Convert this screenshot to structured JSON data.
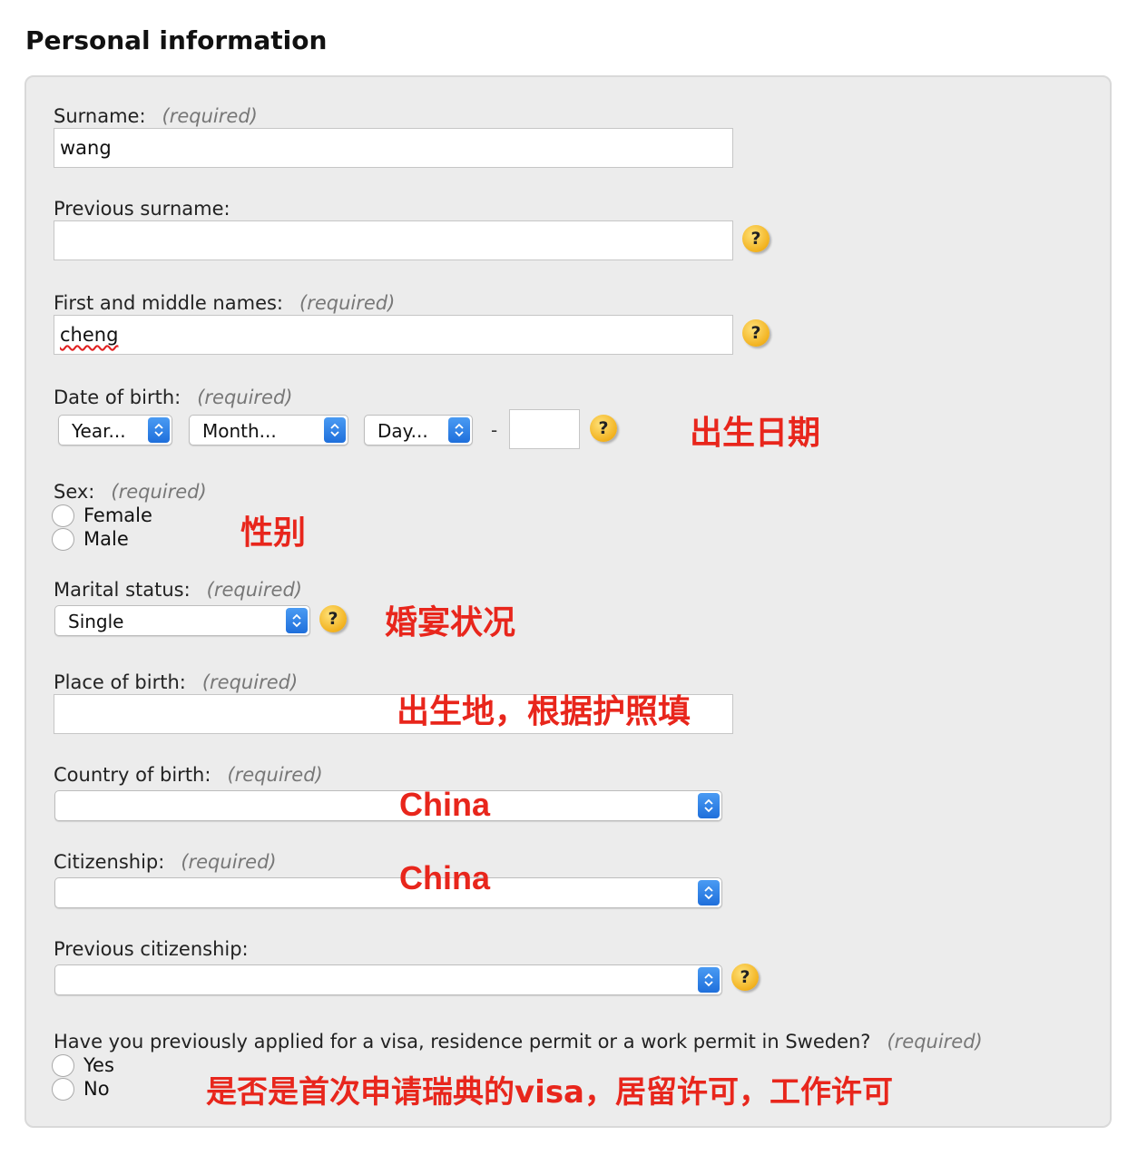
{
  "section_title": "Personal information",
  "required_text": "(required)",
  "fields": {
    "surname": {
      "label": "Surname:",
      "value": "wang"
    },
    "previous_surname": {
      "label": "Previous surname:",
      "value": ""
    },
    "first_names": {
      "label": "First and middle names:",
      "value": "cheng"
    },
    "date_of_birth": {
      "label": "Date of birth:",
      "year": "Year...",
      "month": "Month...",
      "day": "Day...",
      "separator": "-",
      "extra_value": ""
    },
    "sex": {
      "label": "Sex:",
      "options": [
        "Female",
        "Male"
      ]
    },
    "marital_status": {
      "label": "Marital status:",
      "value": "Single"
    },
    "place_of_birth": {
      "label": "Place of birth:",
      "value": ""
    },
    "country_of_birth": {
      "label": "Country of birth:",
      "value": ""
    },
    "citizenship": {
      "label": "Citizenship:",
      "value": ""
    },
    "previous_citizenship": {
      "label": "Previous citizenship:",
      "value": ""
    },
    "previous_application": {
      "label": "Have you previously applied for a visa, residence permit or a work permit in Sweden?",
      "options": [
        "Yes",
        "No"
      ]
    }
  },
  "help_icon_text": "?",
  "annotations": {
    "date_of_birth": "出生日期",
    "sex": "性别",
    "marital_status": "婚宴状况",
    "place_of_birth": "出生地，根据护照填",
    "country_of_birth": "China",
    "citizenship": "China",
    "previous_application": "是否是首次申请瑞典的visa，居留许可，工作许可"
  },
  "colors": {
    "annotation": "#e8261c",
    "panel_bg": "#ececec",
    "select_arrow": "#2a7de8",
    "help_icon": "#f2b21f"
  }
}
